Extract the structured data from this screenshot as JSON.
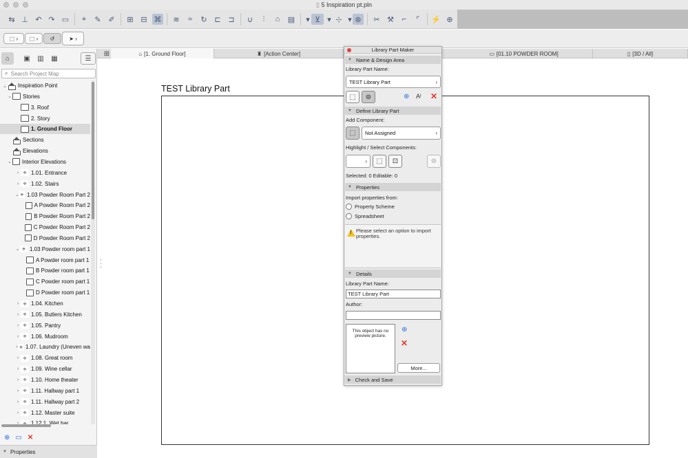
{
  "window": {
    "title": "5 Inspiration pt.pln"
  },
  "tabs": [
    {
      "label": "[1. Ground Floor]",
      "active": true
    },
    {
      "label": "[Action Center]",
      "active": false
    },
    {
      "label": "[01.10 POWDER ROOM]",
      "active": false
    },
    {
      "label": "[3D / All]",
      "active": false
    }
  ],
  "navigator": {
    "search_placeholder": "Search Project Map",
    "items": [
      {
        "label": "Inspiration Point",
        "level": 0,
        "expand": "v",
        "icon": "house"
      },
      {
        "label": "Stories",
        "level": 1,
        "expand": "v",
        "icon": "stair"
      },
      {
        "label": "3. Roof",
        "level": 2,
        "expand": "",
        "icon": "stair"
      },
      {
        "label": "2. Story",
        "level": 2,
        "expand": "",
        "icon": "stair"
      },
      {
        "label": "1. Ground Floor",
        "level": 2,
        "expand": "",
        "icon": "stair",
        "selected": true
      },
      {
        "label": "Sections",
        "level": 1,
        "expand": "",
        "icon": "house"
      },
      {
        "label": "Elevations",
        "level": 1,
        "expand": "",
        "icon": "house"
      },
      {
        "label": "Interior Elevations",
        "level": 1,
        "expand": "v",
        "icon": "frame"
      },
      {
        "label": "1.01. Entrance",
        "level": 2,
        "expand": ">",
        "icon": "cam"
      },
      {
        "label": "1.02. Stairs",
        "level": 2,
        "expand": ">",
        "icon": "cam"
      },
      {
        "label": "1.03 Powder Room Part 2",
        "level": 2,
        "expand": "v",
        "icon": "cam"
      },
      {
        "label": "A Powder Room Part 2",
        "level": 3,
        "expand": "",
        "icon": "frame"
      },
      {
        "label": "B Powder Room Part 2",
        "level": 3,
        "expand": "",
        "icon": "frame"
      },
      {
        "label": "C Powder Room Part 2",
        "level": 3,
        "expand": "",
        "icon": "frame"
      },
      {
        "label": "D Powder Room Part 2",
        "level": 3,
        "expand": "",
        "icon": "frame"
      },
      {
        "label": "1.03 Powder room part 1",
        "level": 2,
        "expand": "v",
        "icon": "cam"
      },
      {
        "label": "A Powder room part 1",
        "level": 3,
        "expand": "",
        "icon": "frame"
      },
      {
        "label": "B Powder room part 1",
        "level": 3,
        "expand": "",
        "icon": "frame"
      },
      {
        "label": "C Powder room part 1",
        "level": 3,
        "expand": "",
        "icon": "frame"
      },
      {
        "label": "D Powder room part 1",
        "level": 3,
        "expand": "",
        "icon": "frame"
      },
      {
        "label": "1.04. Kitchen",
        "level": 2,
        "expand": ">",
        "icon": "cam"
      },
      {
        "label": "1.05. Butlers Kitchen",
        "level": 2,
        "expand": ">",
        "icon": "cam"
      },
      {
        "label": "1.05. Pantry",
        "level": 2,
        "expand": ">",
        "icon": "cam"
      },
      {
        "label": "1.06. Mudroom",
        "level": 2,
        "expand": ">",
        "icon": "cam"
      },
      {
        "label": "1.07. Laundry (Uneven wa",
        "level": 2,
        "expand": ">",
        "icon": "cam"
      },
      {
        "label": "1.08. Great room",
        "level": 2,
        "expand": ">",
        "icon": "cam"
      },
      {
        "label": "1.09. Wine cellar",
        "level": 2,
        "expand": ">",
        "icon": "cam"
      },
      {
        "label": "1.10. Home theater",
        "level": 2,
        "expand": ">",
        "icon": "cam"
      },
      {
        "label": "1.11. Hallway part 1",
        "level": 2,
        "expand": ">",
        "icon": "cam"
      },
      {
        "label": "1.11. Hallway part 2",
        "level": 2,
        "expand": ">",
        "icon": "cam"
      },
      {
        "label": "1.12. Master suite",
        "level": 2,
        "expand": ">",
        "icon": "cam"
      },
      {
        "label": "1.12.1. Wet bar",
        "level": 2,
        "expand": ">",
        "icon": "cam"
      }
    ],
    "properties_label": "Properties"
  },
  "canvas": {
    "title": "TEST Library Part"
  },
  "palette": {
    "title": "Library Part Maker",
    "name_section": {
      "header": "Name & Design Area",
      "label": "Library Part Name:",
      "value": "TEST Library Part"
    },
    "define_section": {
      "header": "Define Library Part",
      "add_component_label": "Add Component:",
      "component_value": "Not Assigned",
      "highlight_label": "Highlight / Select Components:",
      "selected_text": "Selected: 0 Editable: 0"
    },
    "properties_section": {
      "header": "Properties",
      "import_label": "Import properties from:",
      "option1": "Property Scheme",
      "option2": "Spreadsheet",
      "warning": "Please select an option to import properties."
    },
    "details_section": {
      "header": "Details",
      "name_label": "Library Part Name:",
      "name_value": "TEST Library Part",
      "author_label": "Author:",
      "author_value": "",
      "preview_text": "This object has no preview picture.",
      "more_label": "More..."
    },
    "check_section": {
      "header": "Check and Save"
    }
  },
  "colors": {
    "accent": "#2d6fe0",
    "delete_red": "#e0392f",
    "warning_yellow": "#f2c21b"
  }
}
